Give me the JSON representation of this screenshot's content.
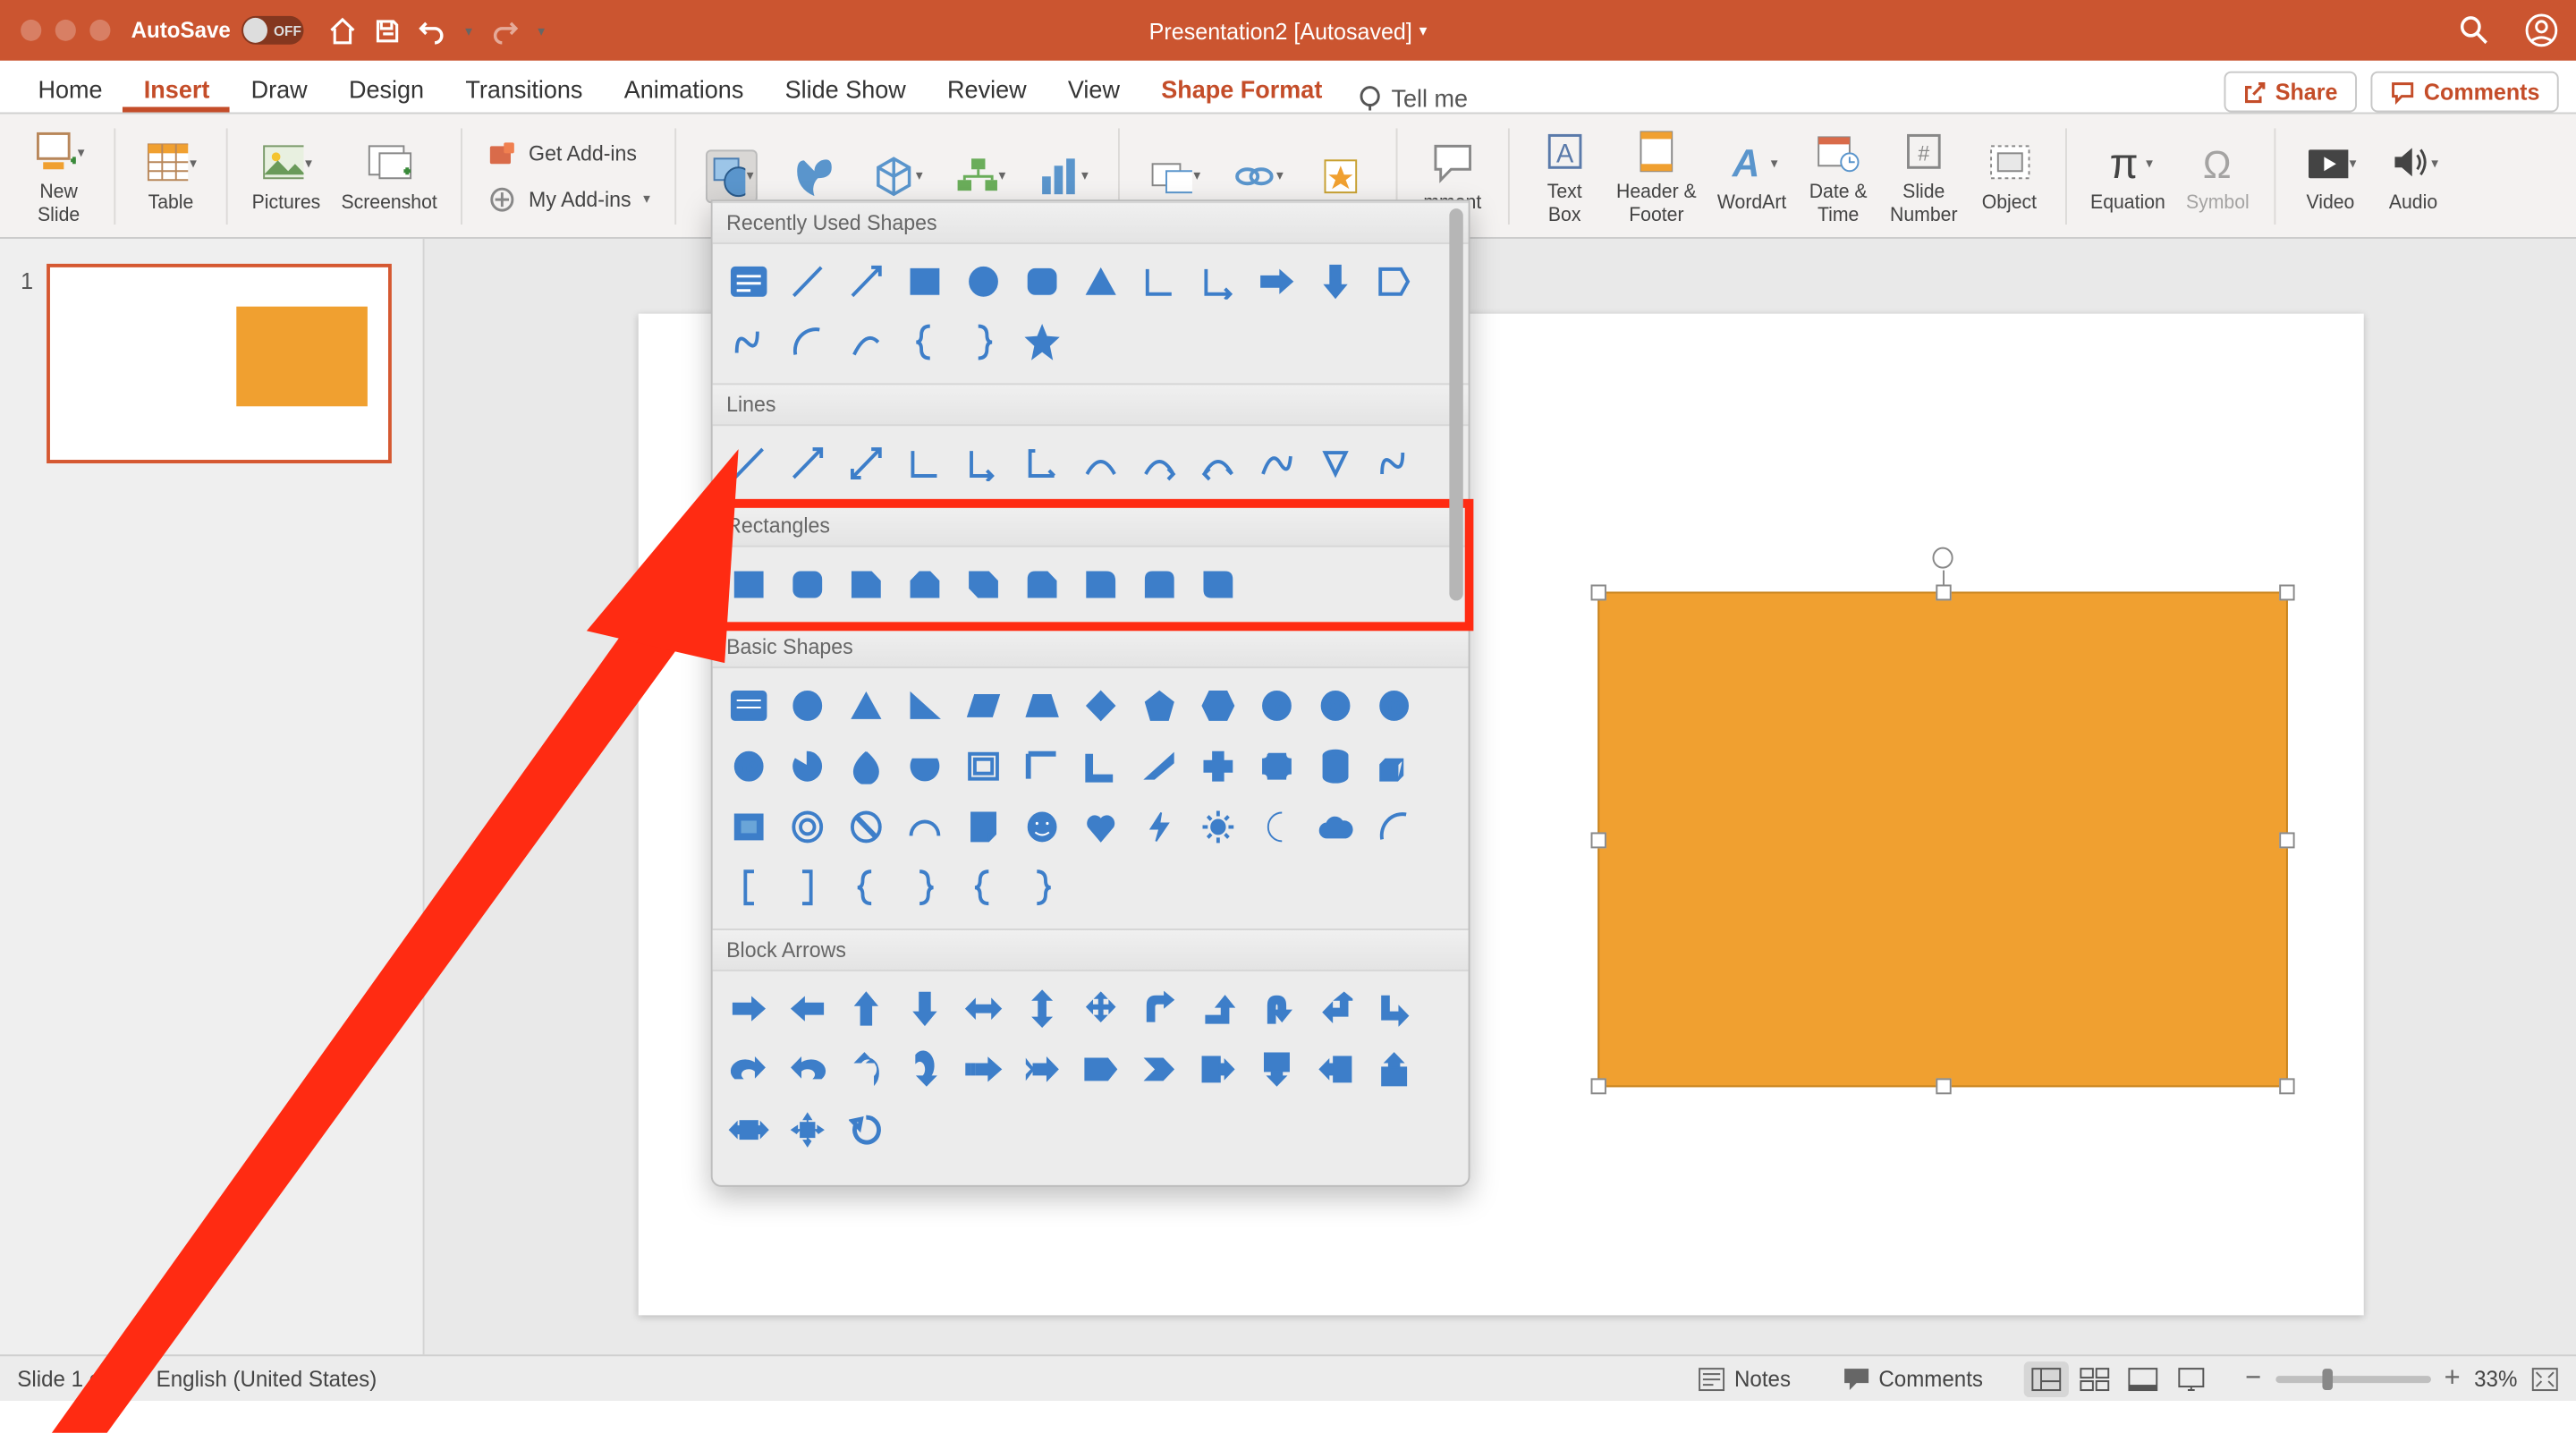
{
  "titlebar": {
    "autosave_label": "AutoSave",
    "autosave_state": "OFF",
    "document_title": "Presentation2 [Autosaved]"
  },
  "tabs": {
    "items": [
      "Home",
      "Insert",
      "Draw",
      "Design",
      "Transitions",
      "Animations",
      "Slide Show",
      "Review",
      "View"
    ],
    "active": "Insert",
    "context_tab": "Shape Format",
    "tell_me": "Tell me",
    "share": "Share",
    "comments": "Comments"
  },
  "ribbon": {
    "new_slide": "New\nSlide",
    "table": "Table",
    "pictures": "Pictures",
    "screenshot": "Screenshot",
    "get_addins": "Get Add-ins",
    "my_addins": "My Add-ins",
    "comment_partial": "mment",
    "text_box": "Text\nBox",
    "header_footer": "Header &\nFooter",
    "wordart": "WordArt",
    "date_time": "Date &\nTime",
    "slide_number": "Slide\nNumber",
    "object": "Object",
    "equation": "Equation",
    "symbol": "Symbol",
    "video": "Video",
    "audio": "Audio"
  },
  "shapes_dropdown": {
    "sections": {
      "recent": "Recently Used Shapes",
      "lines": "Lines",
      "rectangles": "Rectangles",
      "basic": "Basic Shapes",
      "block_arrows": "Block Arrows"
    }
  },
  "thumbnails": {
    "slide1_num": "1"
  },
  "statusbar": {
    "slide_info": "Slide 1 of 1",
    "language": "English (United States)",
    "notes": "Notes",
    "comments": "Comments",
    "zoom_pct": "33%"
  },
  "annotation": {
    "highlight_section": "Rectangles"
  }
}
